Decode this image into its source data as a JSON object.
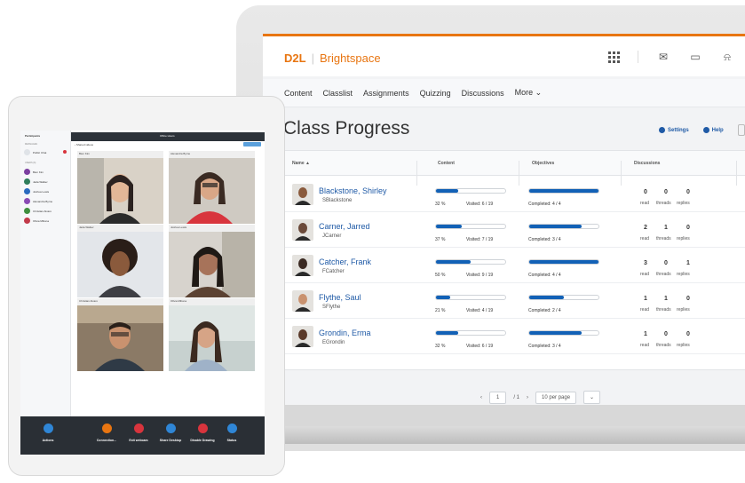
{
  "brand": {
    "logo": "D2L",
    "product": "Brightspace",
    "color": "#e87511"
  },
  "header_icons": [
    "apps-grid-icon",
    "mail-icon",
    "chat-icon",
    "bell-icon"
  ],
  "nav": {
    "items": [
      "Content",
      "Classlist",
      "Assignments",
      "Quizzing",
      "Discussions",
      "More"
    ]
  },
  "page": {
    "title": "Class Progress",
    "settings_label": "Settings",
    "help_label": "Help"
  },
  "table": {
    "columns": [
      "Name ▲",
      "Content",
      "Objectives",
      "Discussions"
    ],
    "rows": [
      {
        "name": "Blackstone, Shirley",
        "username": "SBlackstone",
        "content_pct": "32 %",
        "content_fill": 0.32,
        "visited": "Visited: 6 / 19",
        "objectives_fill": 1.0,
        "completed": "Completed: 4 / 4",
        "read": "0",
        "threads": "0",
        "replies": "0"
      },
      {
        "name": "Carner, Jarred",
        "username": "JCarner",
        "content_pct": "37 %",
        "content_fill": 0.37,
        "visited": "Visited: 7 / 19",
        "objectives_fill": 0.75,
        "completed": "Completed: 3 / 4",
        "read": "2",
        "threads": "1",
        "replies": "0"
      },
      {
        "name": "Catcher, Frank",
        "username": "FCatcher",
        "content_pct": "50 %",
        "content_fill": 0.5,
        "visited": "Visited: 9 / 19",
        "objectives_fill": 1.0,
        "completed": "Completed: 4 / 4",
        "read": "3",
        "threads": "0",
        "replies": "1"
      },
      {
        "name": "Flythe, Saul",
        "username": "SFlythe",
        "content_pct": "21 %",
        "content_fill": 0.21,
        "visited": "Visited: 4 / 19",
        "objectives_fill": 0.5,
        "completed": "Completed: 2 / 4",
        "read": "1",
        "threads": "1",
        "replies": "0"
      },
      {
        "name": "Grondin, Erma",
        "username": "EGrondin",
        "content_pct": "32 %",
        "content_fill": 0.32,
        "visited": "Visited: 6 / 19",
        "objectives_fill": 0.75,
        "completed": "Completed: 3 / 4",
        "read": "1",
        "threads": "0",
        "replies": "0"
      }
    ],
    "disc_labels": {
      "read": "read",
      "threads": "threads",
      "replies": "replies"
    }
  },
  "pager": {
    "prev": "‹",
    "page": "1",
    "of": "/ 1",
    "next": "›",
    "per_page": "10 per page"
  },
  "tablet": {
    "sidebar_title": "Participants",
    "section_messages": "MESSAGES",
    "public_chat": "Public Chat",
    "section_users": "USERS (6)",
    "users": [
      "Bien Kim",
      "Jada Walker",
      "Joshua Lewis",
      "Alexandra Byrne",
      "Christian Alvaro",
      "Olivia Miltona"
    ],
    "top_title": "Office Hours",
    "shared_label": "‹ Shared videos",
    "tiles": [
      "Bien Kim",
      "Alexandra Byrne",
      "Jada Walker",
      "Joshua Lewis",
      "Christian Alvaro",
      "Olivia Miltona"
    ],
    "actions": [
      "Actions",
      "Connection...",
      "Exit webcam",
      "Share Desktop",
      "Disable Drawing",
      "Status"
    ]
  }
}
